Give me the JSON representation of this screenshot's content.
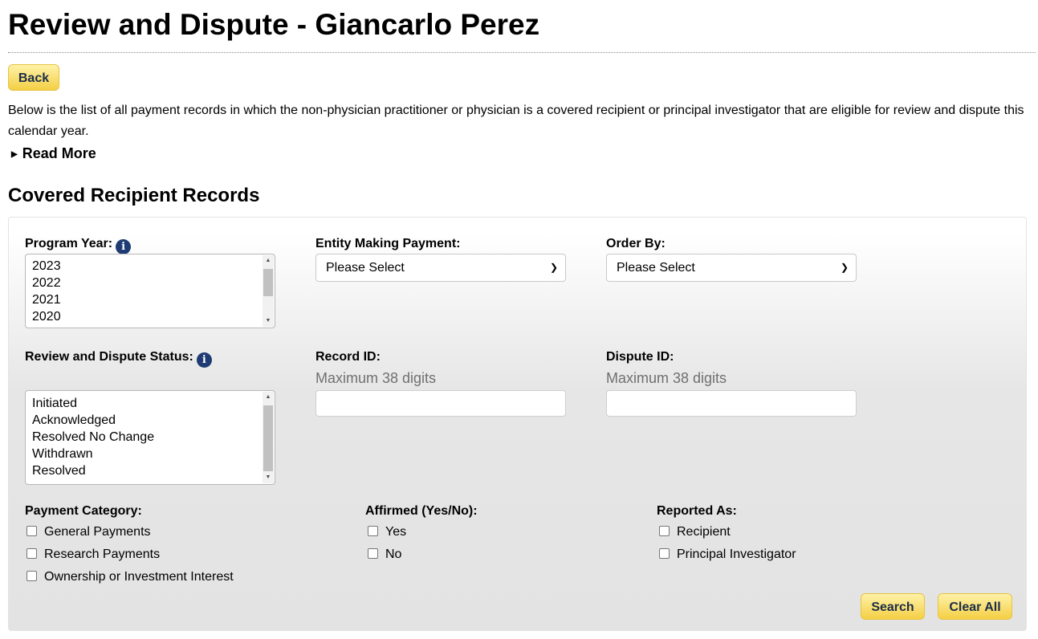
{
  "page": {
    "title": "Review and Dispute - Giancarlo Perez",
    "back_label": "Back",
    "intro": "Below is the list of all payment records in which the non-physician practitioner or physician is a covered recipient or principal investigator that are eligible for review and dispute this calendar year.",
    "read_more": "Read More",
    "section_title": "Covered Recipient Records"
  },
  "filters": {
    "program_year": {
      "label": "Program Year:",
      "options": [
        "2023",
        "2022",
        "2021",
        "2020"
      ]
    },
    "entity": {
      "label": "Entity Making Payment:",
      "selected": "Please Select"
    },
    "order_by": {
      "label": "Order By:",
      "selected": "Please Select"
    },
    "status": {
      "label": "Review and Dispute Status:",
      "options": [
        "Initiated",
        "Acknowledged",
        "Resolved No Change",
        "Withdrawn",
        "Resolved"
      ]
    },
    "record_id": {
      "label": "Record ID:",
      "hint": "Maximum 38 digits",
      "value": ""
    },
    "dispute_id": {
      "label": "Dispute ID:",
      "hint": "Maximum 38 digits",
      "value": ""
    },
    "payment_category": {
      "label": "Payment Category:",
      "options": [
        "General Payments",
        "Research Payments",
        "Ownership or Investment Interest"
      ]
    },
    "affirmed": {
      "label": "Affirmed (Yes/No):",
      "options": [
        "Yes",
        "No"
      ]
    },
    "reported_as": {
      "label": "Reported As:",
      "options": [
        "Recipient",
        "Principal Investigator"
      ]
    },
    "search_label": "Search",
    "clear_label": "Clear All"
  },
  "colors": {
    "button_bg": "#f4cf45",
    "button_text": "#1b2e4a",
    "info_icon": "#1f3b73"
  }
}
